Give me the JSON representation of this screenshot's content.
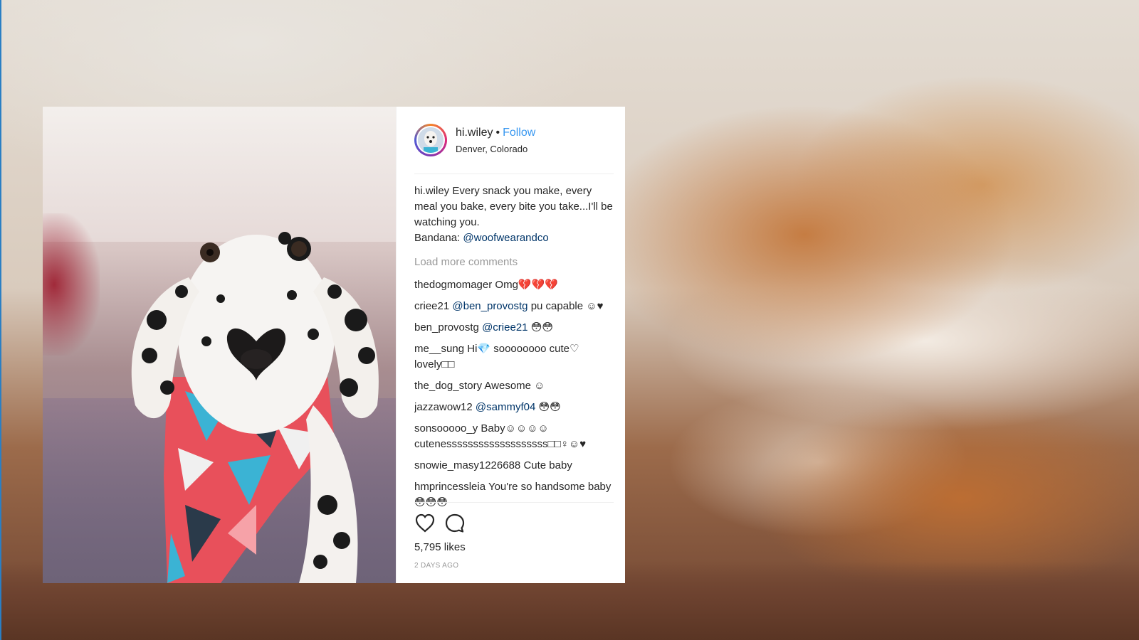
{
  "post": {
    "username": "hi.wiley",
    "separator": "•",
    "follow_label": "Follow",
    "location": "Denver, Colorado",
    "caption_user": "hi.wiley",
    "caption_lines": [
      "Every snack you make, every meal you bake, every bite you take...I'll be watching you.",
      "Bandana:"
    ],
    "caption_mention": "@woofwearandco",
    "load_more_label": "Load more comments",
    "comments": [
      {
        "user": "thedogmomager",
        "mention": "",
        "text": "Omg💔💔💔"
      },
      {
        "user": "criee21",
        "mention": "@ben_provostg",
        "text": "pu capable ☺♥"
      },
      {
        "user": "ben_provostg",
        "mention": "@criee21",
        "text": "😳😳"
      },
      {
        "user": "me__sung",
        "mention": "",
        "text": "Hi💎 soooooooo cute♡ lovely□□"
      },
      {
        "user": "the_dog_story",
        "mention": "",
        "text": "Awesome ☺"
      },
      {
        "user": "jazzawow12",
        "mention": "@sammyf04",
        "text": "😳😳"
      },
      {
        "user": "sonsooooo_y",
        "mention": "",
        "text": "Baby☺☺☺☺ cutenesssssssssssssssssss□□♀☺♥"
      },
      {
        "user": "snowie_masy1226688",
        "mention": "",
        "text": "Cute baby"
      },
      {
        "user": "hmprincessleia",
        "mention": "",
        "text": "You're so handsome baby 😳😳😳"
      }
    ],
    "likes": "5,795 likes",
    "time_ago": "2 DAYS AGO"
  },
  "colors": {
    "link": "#003569",
    "follow": "#3897f0",
    "muted": "#999999"
  },
  "icons": {
    "like": "heart-outline-icon",
    "comment": "comment-bubble-icon"
  }
}
